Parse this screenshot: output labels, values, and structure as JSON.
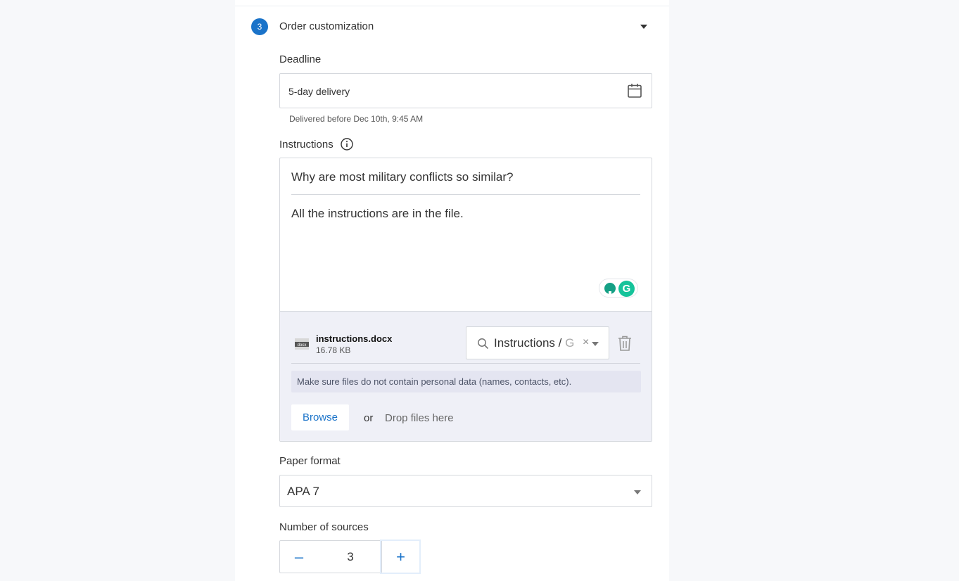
{
  "step": {
    "number": "3",
    "title": "Order customization"
  },
  "deadline": {
    "label": "Deadline",
    "value": "5-day delivery",
    "hint": "Delivered before Dec 10th, 9:45 AM"
  },
  "instructions": {
    "label": "Instructions",
    "title": "Why are most military conflicts so similar?",
    "body": "All the instructions are in the file."
  },
  "attachment": {
    "file_name": "instructions.docx",
    "file_size": "16.78 KB",
    "category_value": "Instructions / ",
    "category_ghost": "G",
    "category_clear": "×"
  },
  "upload": {
    "privacy_note": "Make sure files do not contain personal data (names, contacts, etc).",
    "browse_label": "Browse",
    "or_label": "or",
    "drop_label": "Drop files here"
  },
  "paper_format": {
    "label": "Paper format",
    "value": "APA 7"
  },
  "sources": {
    "label": "Number of sources",
    "value": "3",
    "minus": "–",
    "plus": "+"
  },
  "colors": {
    "accent": "#1a73c9",
    "file_area_bg": "#eff0f7",
    "grammarly": "#15c39a"
  },
  "icons": {
    "calendar": "calendar-icon",
    "info": "info-icon",
    "search": "search-icon",
    "trash": "trash-icon",
    "document": "docx-file-icon",
    "grammarly": "grammarly-icon",
    "caret": "chevron-down-icon"
  }
}
